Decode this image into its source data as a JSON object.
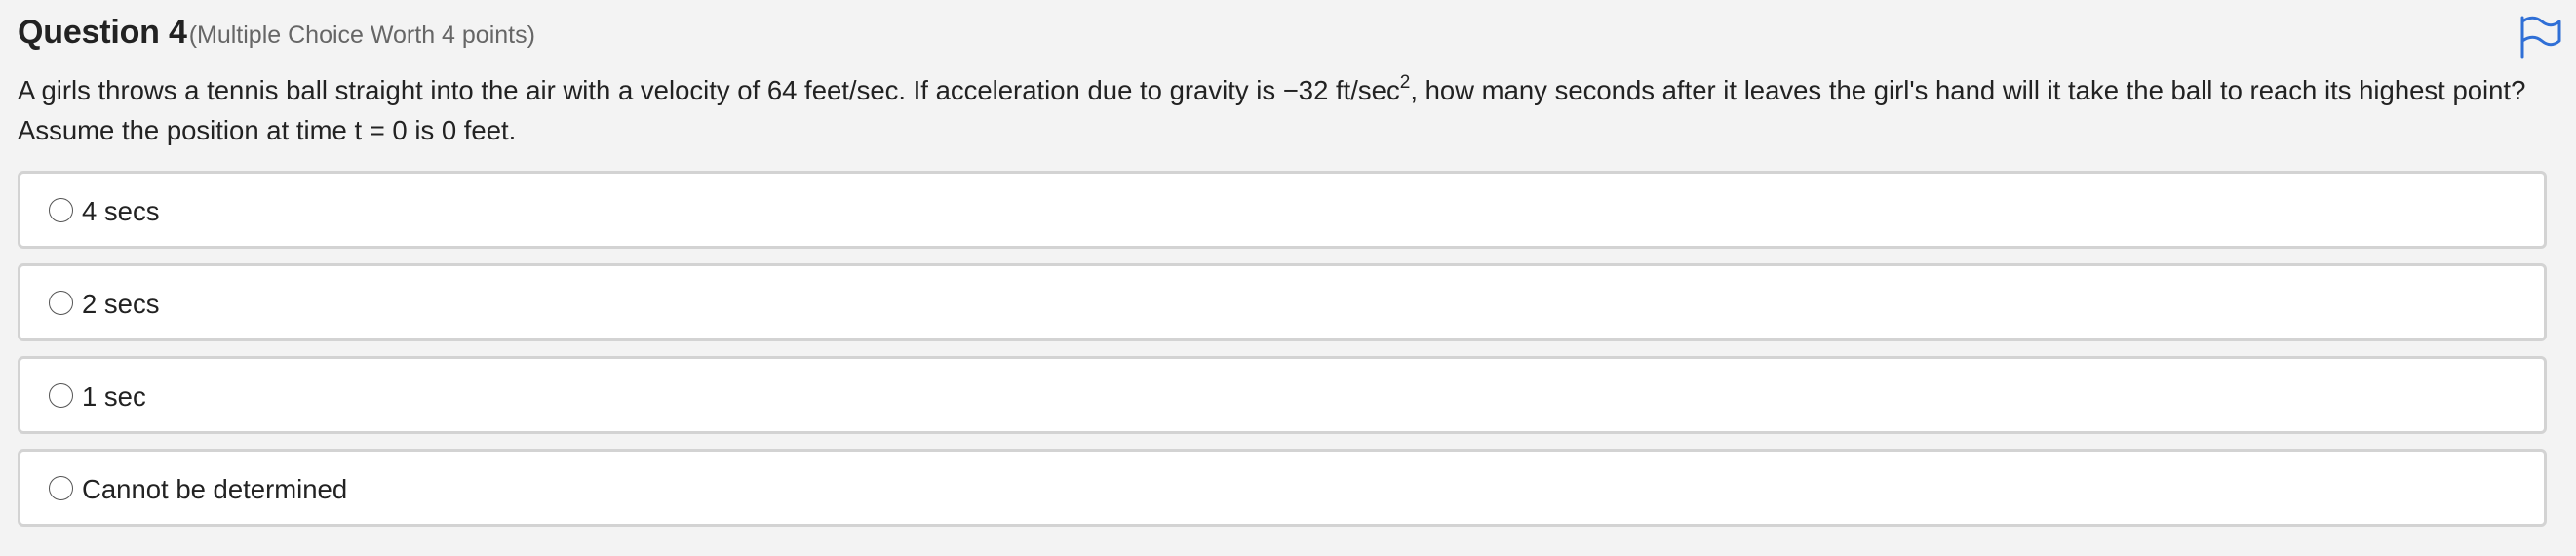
{
  "question": {
    "title": "Question 4",
    "points_label": "(Multiple Choice Worth 4 points)",
    "prompt": {
      "part1": "A girls throws a tennis ball straight into the air with a velocity of 64 feet/sec. If acceleration due to gravity is −32 ft/sec",
      "superscript": "2",
      "part2": ", how many seconds after it leaves the girl's hand will it take the ball to reach its highest point? Assume the position at time t = 0 is 0 feet."
    },
    "flag_icon": "flag-icon",
    "accent_color": "#2f6fd6",
    "choices": [
      {
        "label": "4 secs"
      },
      {
        "label": "2 secs"
      },
      {
        "label": "1 sec"
      },
      {
        "label": "Cannot be determined"
      }
    ]
  }
}
